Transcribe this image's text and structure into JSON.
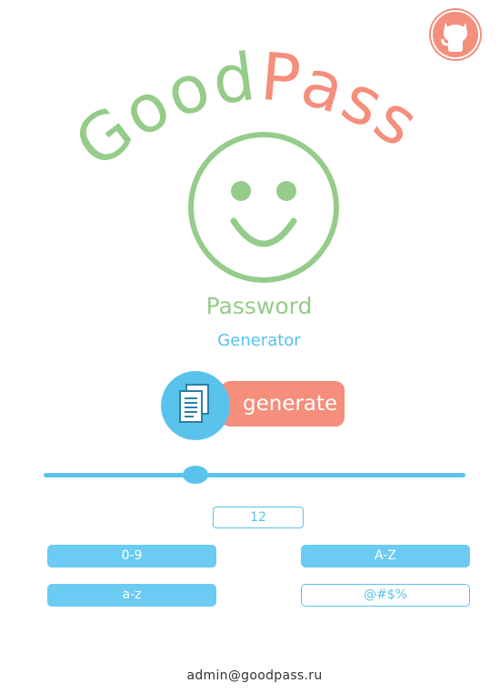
{
  "logo": {
    "good": "Good",
    "pass": "Pass"
  },
  "subtitle": {
    "line1": "Password",
    "line2": "Generator"
  },
  "actions": {
    "generate_label": "generate"
  },
  "length": {
    "value": "12",
    "slider_fraction": 0.36
  },
  "options": {
    "digits": "0-9",
    "uppercase": "A-Z",
    "lowercase": "a-z",
    "special": "@#$%"
  },
  "option_states": {
    "digits": true,
    "uppercase": true,
    "lowercase": true,
    "special": false
  },
  "footer": {
    "email": "admin@goodpass.ru"
  },
  "colors": {
    "green": "#95cc8a",
    "salmon": "#f58e7b",
    "blue": "#5ac3ec"
  },
  "icons": {
    "corner": "github-octocat-icon",
    "copy": "copy-documents-icon"
  }
}
